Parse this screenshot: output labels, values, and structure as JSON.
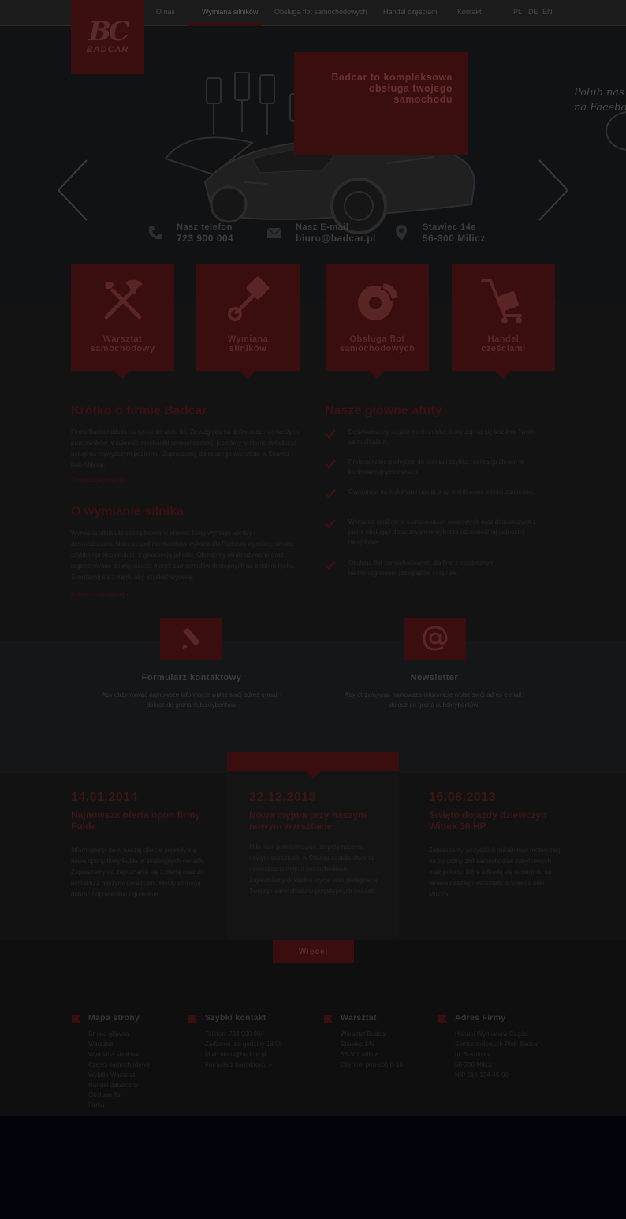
{
  "nav": {
    "items": [
      "O nas",
      "Wymiana silników",
      "Obsługa flot samochodowych",
      "Handel częściami",
      "Kontakt"
    ],
    "languages": [
      "PL",
      "DE",
      "EN"
    ]
  },
  "logo": {
    "text": "BADCAR"
  },
  "hero": {
    "headline": [
      "Badcar to kompleksowa",
      "obsługa twojego",
      "samochodu"
    ],
    "facebook_text": [
      "Polub nas",
      "na Facebook"
    ]
  },
  "contacts": [
    {
      "label": "Nasz telefon",
      "value": "723 900 004",
      "icon": "phone-icon"
    },
    {
      "label": "Nasz E-mail",
      "value": "biuro@badcar.pl",
      "icon": "mail-icon"
    },
    {
      "label": "Stawiec 14e",
      "value": "56-300 Milicz",
      "icon": "map-pin-icon"
    }
  ],
  "services": [
    {
      "label": [
        "Warsztat",
        "samochodowy"
      ],
      "icon": "tools-icon"
    },
    {
      "label": [
        "Wymiana",
        "silników"
      ],
      "icon": "piston-icon"
    },
    {
      "label": [
        "Obsługa flot",
        "samochodowych"
      ],
      "icon": "brake-disc-icon"
    },
    {
      "label": [
        "Handel",
        "częściami"
      ],
      "icon": "parts-cart-icon"
    }
  ],
  "about": {
    "title": "Krótko o firmie Badcar",
    "text": "Firma Badcar działa na rynku od wielu lat. Ze względu na doświadczenie naszych pracowników w zakresie mechaniki samochodowej, jesteśmy w stanie świadczyć usługi na najwyższym poziomie. Zapraszamy do naszego warsztatu w Stawcu koło Milicza.",
    "more": "Dowiedz się więcej »"
  },
  "engine": {
    "title": "O wymianie silnika",
    "text": "Wymiana silnika to skomplikowany proces, który wymaga wiedzy i doświadczenia. Nasz zespół mechaników wykona dla Państwa wymianę silnika szybko i profesjonalnie, z gwarancją jakości. Oferujemy silniki używane oraz regenerowane do większości marek samochodów dostępnych na polskim rynku. Skontaktuj się z nami, aby uzyskać wycenę.",
    "more": "Dowiedz się więcej »"
  },
  "advantages": {
    "title": "Nasze główne atuty",
    "items": [
      "Doświadczony zespół mechaników, który zajmie się każdym Twoim samochodem.",
      "Profesjonalne podejście do klienta i szybka realizacja zleceń w konkurencyjnych cenach.",
      "Gwarancja na wykonane usługi oraz montowane części zamienne.",
      "Wymiana silników w samochodach osobowych oraz dostawczych z pełną obsługą i doradztwem w wyborze odpowiedniej jednostki napędowej.",
      "Obsługa flot samochodowych dla firm z elastycznym harmonogramem przeglądów i napraw."
    ]
  },
  "contact_form": {
    "title": "Formularz kontaktowy",
    "text": "Aby otrzymywać najnowsze informacje wpisz swój adres e-mail i dołącz do grona subskrybentów."
  },
  "newsletter": {
    "title": "Newsletter",
    "text": "Aby otrzymywać najnowsze informacje wpisz swój adres e-mail i dołącz do grona subskrybentów."
  },
  "news": [
    {
      "date": "14.01.2014",
      "title": "Najnowsza oferta opon firmy Fulda",
      "text": "Informujemy, że w naszej ofercie pojawiły się nowe opony firmy Fulda w atrakcyjnych cenach. Zapraszamy do zapoznania się z ofertą oraz do kontaktu z naszymi doradcami, którzy pomogą dobrać odpowiednie ogumienie."
    },
    {
      "date": "22.12.2013",
      "title": "Nowa myjnia przy naszym nowym warsztacie",
      "text": "Miło nam poinformować, że przy naszym nowym warsztacie w Stawcu została otwarta nowoczesna myjnia samochodowa. Zapewniamy dokładne mycie oraz pielęgnację Twojego samochodu w przystępnych cenach."
    },
    {
      "date": "16.08.2013",
      "title": "Święto dojazdy dziewczyn Wittek 30 HP",
      "text": "Zapraszamy wszystkich miłośników motoryzacji na coroczny zlot samochodów zabytkowych oraz pokazy, które odbędą się w sierpniu na terenie naszego warsztatu w Stawcu koło Milicza."
    }
  ],
  "more_button": "Więcej",
  "footer": [
    {
      "title": "Mapa strony",
      "items": [
        "Strona główna",
        "Warsztat",
        "Wymiana silników",
        "Części samochodowe",
        "Wybitki Warsztat",
        "Handel detaliczny",
        "Obsługa flot",
        "Firma"
      ]
    },
    {
      "title": "Szybki kontakt",
      "items": [
        "Telefon: 723 900 004",
        "Zadzwoń: do godziny 18:00",
        "Mail: biuro@badcar.pl",
        "Formularz kontaktowy »"
      ]
    },
    {
      "title": "Warsztat",
      "items": [
        "Warsztat Badcar",
        "Stawiec 14e",
        "56-300 Milicz",
        "Czynne: pon-sob 8-16"
      ]
    },
    {
      "title": "Adres Firmy",
      "items": [
        "Handel Wymianów Części Samochodowych Piotr Badcar",
        "ul. Szkolna 4",
        "56-300 Milicz",
        "NIP 916-134-45-90"
      ]
    }
  ]
}
